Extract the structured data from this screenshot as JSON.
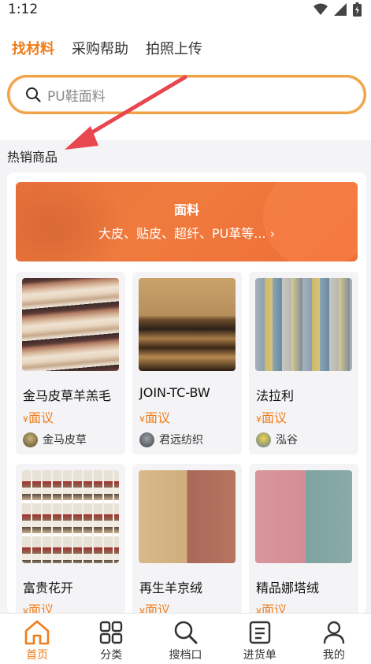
{
  "status": {
    "time": "1:12"
  },
  "tabs": [
    {
      "label": "找材料",
      "active": true
    },
    {
      "label": "采购帮助",
      "active": false
    },
    {
      "label": "拍照上传",
      "active": false
    }
  ],
  "search": {
    "placeholder": "PU鞋面料"
  },
  "section_title": "热销商品",
  "banner": {
    "title": "面料",
    "subtitle": "大皮、贴皮、超纤、PU革等... ›"
  },
  "products": [
    {
      "name": "金马皮草羊羔毛",
      "price_symbol": "¥",
      "price": "面议",
      "seller": "金马皮草"
    },
    {
      "name": "JOIN-TC-BW",
      "price_symbol": "¥",
      "price": "面议",
      "seller": "君远纺织"
    },
    {
      "name": "法拉利",
      "price_symbol": "¥",
      "price": "面议",
      "seller": "泓谷"
    },
    {
      "name": "富贵花开",
      "price_symbol": "¥",
      "price": "面议",
      "seller": ""
    },
    {
      "name": "再生羊京绒",
      "price_symbol": "¥",
      "price": "面议",
      "seller": ""
    },
    {
      "name": "精品娜塔绒",
      "price_symbol": "¥",
      "price": "面议",
      "seller": ""
    }
  ],
  "nav": [
    {
      "label": "首页",
      "icon": "home-icon",
      "active": true
    },
    {
      "label": "分类",
      "icon": "grid-icon",
      "active": false
    },
    {
      "label": "搜档口",
      "icon": "search-icon",
      "active": false
    },
    {
      "label": "进货单",
      "icon": "order-list-icon",
      "active": false
    },
    {
      "label": "我的",
      "icon": "user-icon",
      "active": false
    }
  ],
  "colors": {
    "accent": "#ef7d1a",
    "annotation_arrow": "#e8474f"
  }
}
